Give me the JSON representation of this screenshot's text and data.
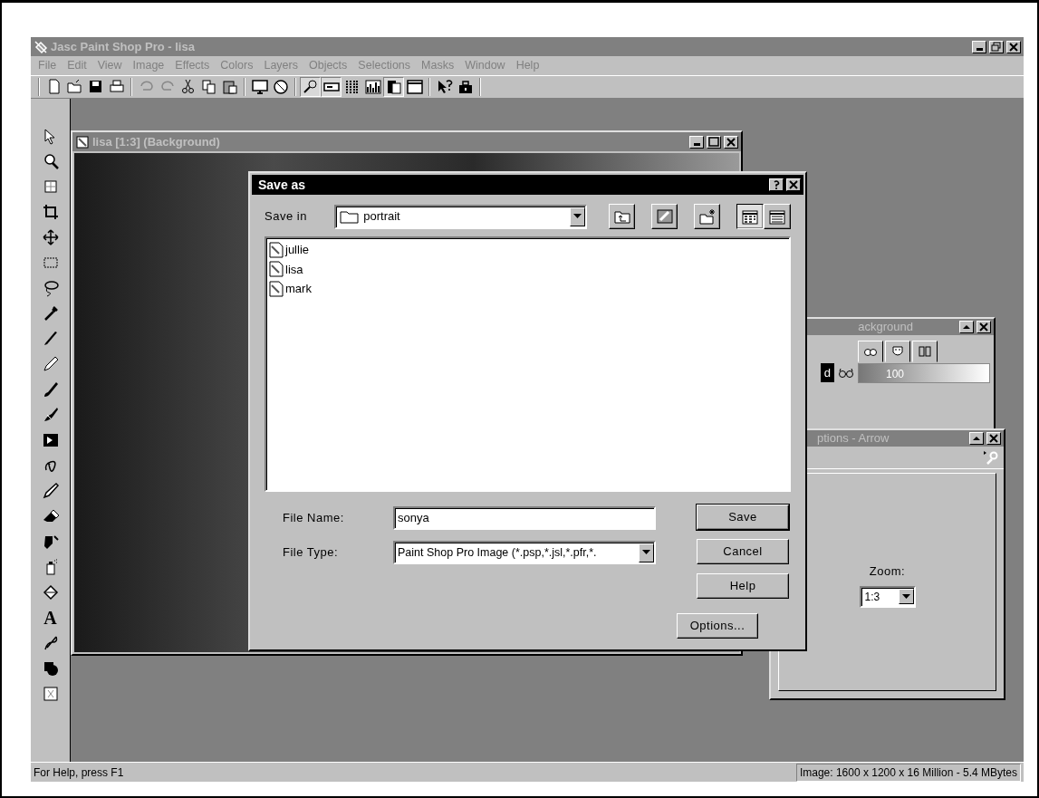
{
  "app": {
    "title": "Jasc Paint Shop Pro - lisa"
  },
  "menu": [
    {
      "label": "File"
    },
    {
      "label": "Edit"
    },
    {
      "label": "View"
    },
    {
      "label": "Image"
    },
    {
      "label": "Effects"
    },
    {
      "label": "Colors"
    },
    {
      "label": "Layers"
    },
    {
      "label": "Objects"
    },
    {
      "label": "Selections"
    },
    {
      "label": "Masks"
    },
    {
      "label": "Window"
    },
    {
      "label": "Help"
    }
  ],
  "toolbar": [
    {
      "pressed": false
    },
    {
      "pressed": false
    },
    {
      "pressed": false
    },
    {
      "pressed": false
    },
    {
      "pressed": false
    },
    {
      "pressed": false
    },
    {
      "pressed": false
    },
    {
      "pressed": false
    },
    {
      "pressed": false
    },
    {
      "pressed": false
    },
    {
      "pressed": false
    },
    {
      "pressed": true
    },
    {
      "pressed": true
    },
    {
      "pressed": false
    },
    {
      "pressed": false
    },
    {
      "pressed": true
    },
    {
      "pressed": false
    },
    {
      "pressed": false
    },
    {
      "pressed": false
    }
  ],
  "text_tool": "A",
  "image_window": {
    "title": "lisa [1:3] (Background)"
  },
  "dialog": {
    "title": "Save as",
    "save_in_label": "Save in",
    "save_in_value": "portrait",
    "view_buttons": [
      {
        "selected": true
      },
      {
        "selected": false
      }
    ],
    "files": [
      {
        "name": "jullie"
      },
      {
        "name": "lisa"
      },
      {
        "name": "mark"
      }
    ],
    "file_name_label": "File Name:",
    "file_name_value": "sonya",
    "file_type_label": "File Type:",
    "file_type_value": "Paint Shop Pro Image (*.psp,*.jsl,*.pfr,*.",
    "buttons": [
      {
        "label": "Save",
        "default": true
      },
      {
        "label": "Cancel",
        "default": false
      },
      {
        "label": "Help",
        "default": false
      },
      {
        "label": "Options...",
        "default": false
      }
    ]
  },
  "layers_palette": {
    "title": "ackground",
    "layer_name": "d",
    "opacity": "100"
  },
  "tool_options": {
    "title": "ptions - Arrow",
    "zoom_label": "Zoom:",
    "zoom_value": "1:3"
  },
  "status_bar": {
    "help": "For Help, press F1",
    "image_info": "Image:  1600 x 1200 x 16 Million - 5.4 MBytes"
  }
}
